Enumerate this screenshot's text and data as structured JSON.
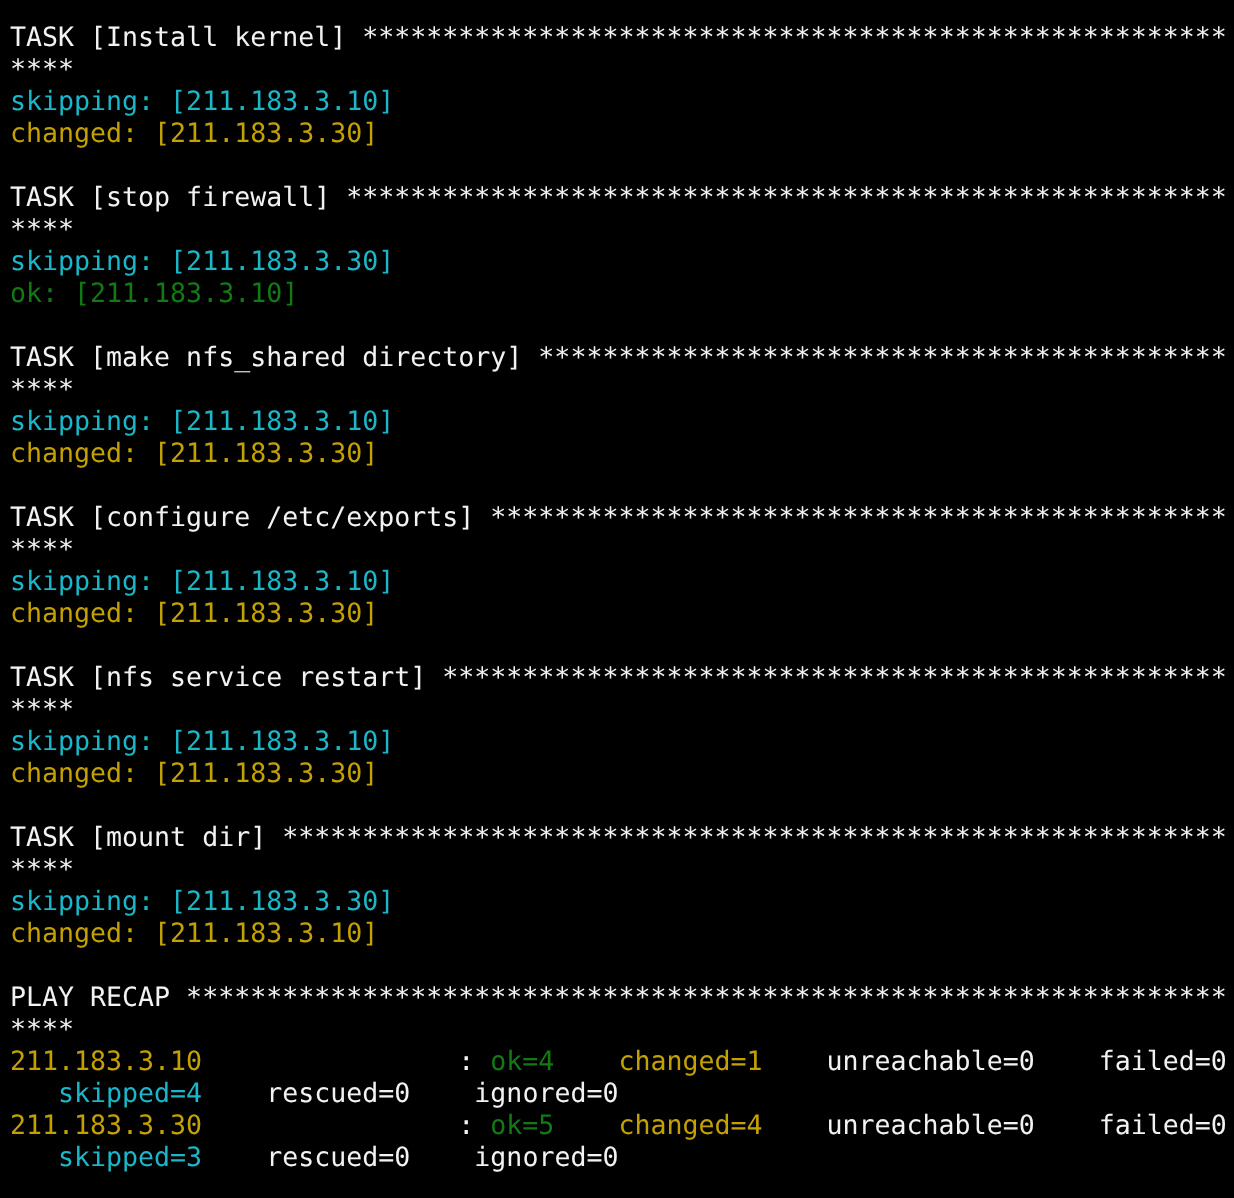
{
  "tasks": [
    {
      "header": "TASK [Install kernel] ******************************************************",
      "header_wrap": "****",
      "results": [
        {
          "kind": "skipping",
          "text": "skipping: [211.183.3.10]"
        },
        {
          "kind": "changed",
          "text": "changed: [211.183.3.30]"
        }
      ]
    },
    {
      "header": "TASK [stop firewall] *******************************************************",
      "header_wrap": "****",
      "results": [
        {
          "kind": "skipping",
          "text": "skipping: [211.183.3.30]"
        },
        {
          "kind": "ok",
          "text": "ok: [211.183.3.10]"
        }
      ]
    },
    {
      "header": "TASK [make nfs_shared directory] *******************************************",
      "header_wrap": "****",
      "results": [
        {
          "kind": "skipping",
          "text": "skipping: [211.183.3.10]"
        },
        {
          "kind": "changed",
          "text": "changed: [211.183.3.30]"
        }
      ]
    },
    {
      "header": "TASK [configure /etc/exports] **********************************************",
      "header_wrap": "****",
      "results": [
        {
          "kind": "skipping",
          "text": "skipping: [211.183.3.10]"
        },
        {
          "kind": "changed",
          "text": "changed: [211.183.3.30]"
        }
      ]
    },
    {
      "header": "TASK [nfs service restart] *************************************************",
      "header_wrap": "****",
      "results": [
        {
          "kind": "skipping",
          "text": "skipping: [211.183.3.10]"
        },
        {
          "kind": "changed",
          "text": "changed: [211.183.3.30]"
        }
      ]
    },
    {
      "header": "TASK [mount dir] ***********************************************************",
      "header_wrap": "****",
      "results": [
        {
          "kind": "skipping",
          "text": "skipping: [211.183.3.30]"
        },
        {
          "kind": "changed",
          "text": "changed: [211.183.3.10]"
        }
      ]
    }
  ],
  "recap": {
    "header": "PLAY RECAP *****************************************************************",
    "header_wrap": "****",
    "hosts": [
      {
        "host": "211.183.3.10",
        "kind": "changed",
        "separator": ":",
        "stats": [
          {
            "kind": "ok",
            "text": "ok=4"
          },
          {
            "kind": "changed",
            "text": "changed=1"
          },
          {
            "kind": "plain",
            "text": "unreachable=0"
          },
          {
            "kind": "plain",
            "text": "failed=0"
          },
          {
            "kind": "skipping",
            "text": "skipped=4"
          },
          {
            "kind": "plain",
            "text": "rescued=0"
          },
          {
            "kind": "plain",
            "text": "ignored=0"
          }
        ]
      },
      {
        "host": "211.183.3.30",
        "kind": "changed",
        "separator": ":",
        "stats": [
          {
            "kind": "ok",
            "text": "ok=5"
          },
          {
            "kind": "changed",
            "text": "changed=4"
          },
          {
            "kind": "plain",
            "text": "unreachable=0"
          },
          {
            "kind": "plain",
            "text": "failed=0"
          },
          {
            "kind": "skipping",
            "text": "skipped=3"
          },
          {
            "kind": "plain",
            "text": "rescued=0"
          },
          {
            "kind": "plain",
            "text": "ignored=0"
          }
        ]
      }
    ]
  }
}
